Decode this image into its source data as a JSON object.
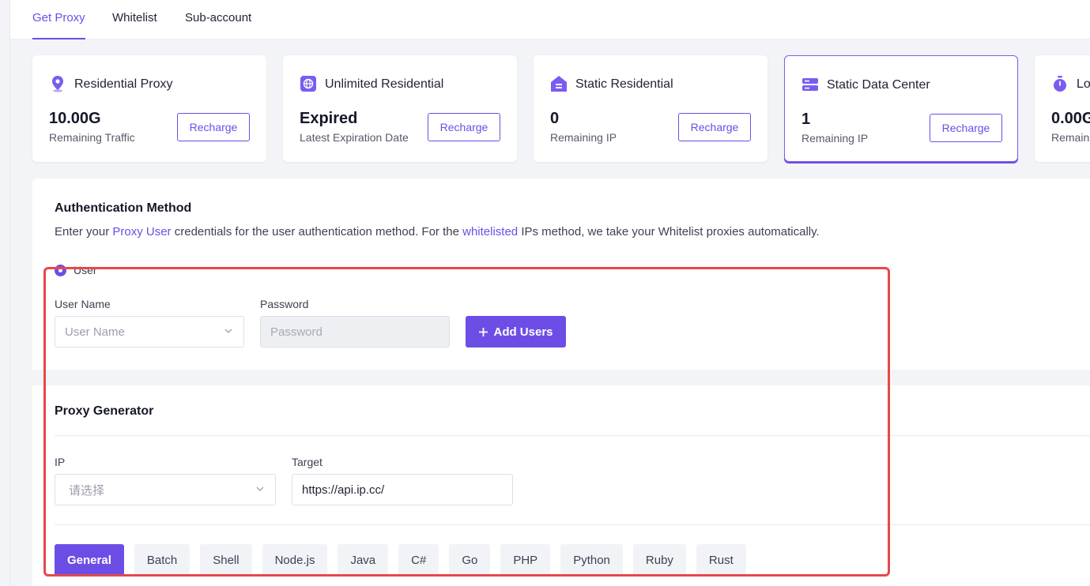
{
  "tabs": [
    {
      "label": "Get Proxy",
      "active": true
    },
    {
      "label": "Whitelist",
      "active": false
    },
    {
      "label": "Sub-account",
      "active": false
    }
  ],
  "cards": [
    {
      "title": "Residential Proxy",
      "value": "10.00G",
      "sub": "Remaining Traffic",
      "button": "Recharge",
      "icon": "location-pin-icon"
    },
    {
      "title": "Unlimited Residential",
      "value": "Expired",
      "sub": "Latest Expiration Date",
      "button": "Recharge",
      "icon": "globe-icon"
    },
    {
      "title": "Static Residential",
      "value": "0",
      "sub": "Remaining IP",
      "button": "Recharge",
      "icon": "home-icon"
    },
    {
      "title": "Static Data Center",
      "value": "1",
      "sub": "Remaining IP",
      "button": "Recharge",
      "icon": "server-icon",
      "selected": true
    },
    {
      "title": "Lo",
      "value": "0.00G",
      "sub": "Remain",
      "icon": "stopwatch-icon"
    }
  ],
  "auth": {
    "title": "Authentication Method",
    "desc_part1": "Enter your ",
    "desc_link1": "Proxy User",
    "desc_part2": " credentials for the user authentication method. For the ",
    "desc_link2": "whitelisted",
    "desc_part3": " IPs method, we take your Whitelist proxies automatically.",
    "radio_label": "User",
    "username_label": "User Name",
    "username_placeholder": "User Name",
    "password_label": "Password",
    "password_placeholder": "Password",
    "add_users": "Add Users"
  },
  "generator": {
    "title": "Proxy Generator",
    "ip_label": "IP",
    "ip_placeholder": "请选择",
    "target_label": "Target",
    "target_value": "https://api.ip.cc/",
    "languages": [
      {
        "label": "General",
        "active": true
      },
      {
        "label": "Batch"
      },
      {
        "label": "Shell"
      },
      {
        "label": "Node.js"
      },
      {
        "label": "Java"
      },
      {
        "label": "C#"
      },
      {
        "label": "Go"
      },
      {
        "label": "PHP"
      },
      {
        "label": "Python"
      },
      {
        "label": "Ruby"
      },
      {
        "label": "Rust"
      }
    ]
  },
  "colors": {
    "accent": "#6c4ee6",
    "highlight": "#e5484d"
  }
}
